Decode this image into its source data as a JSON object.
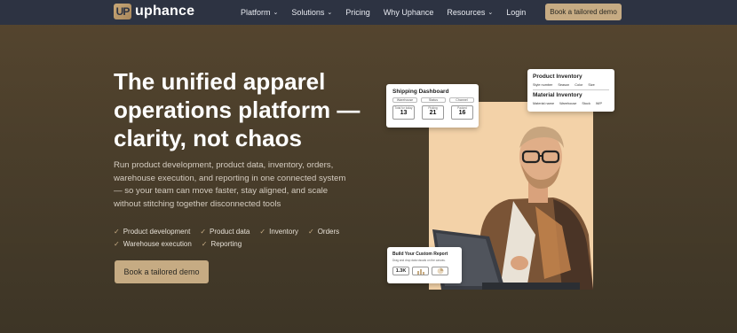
{
  "nav": {
    "brand": "uphance",
    "logo_text": "UP",
    "links": [
      {
        "label": "Platform",
        "has_dropdown": true
      },
      {
        "label": "Solutions",
        "has_dropdown": true
      },
      {
        "label": "Pricing",
        "has_dropdown": false
      },
      {
        "label": "Why Uphance",
        "has_dropdown": false
      },
      {
        "label": "Resources",
        "has_dropdown": true
      },
      {
        "label": "Login",
        "has_dropdown": false
      }
    ],
    "cta_label": "Book a tailored demo"
  },
  "hero": {
    "title": "The unified apparel operations platform — clarity, not chaos",
    "description": "Run product development, product data, inventory, orders, warehouse execution, and reporting in one connected system — so your team can move faster, stay aligned, and scale without stitching together disconnected tools",
    "features": [
      "Product development",
      "Product data",
      "Inventory",
      "Orders",
      "Warehouse execution",
      "Reporting"
    ],
    "cta_label": "Book a tailored demo"
  },
  "shipping_card": {
    "title": "Shipping  Dashboard",
    "filters": [
      "Warehouse",
      "Status",
      "Channel"
    ],
    "stats": [
      {
        "label": "Total for today",
        "value": "13"
      },
      {
        "label": "Picking",
        "value": "21"
      },
      {
        "label": "Packed",
        "value": "16"
      }
    ]
  },
  "inventory_card": {
    "title1": "Product Inventory",
    "cols1": [
      "Style number",
      "Season",
      "Color",
      "Size"
    ],
    "title2": "Material Inventory",
    "cols2": [
      "Material name",
      "Warehouse",
      "Stock",
      "WIP"
    ]
  },
  "report_card": {
    "title": "Build Your Custom Report",
    "subtitle": "Drag and drop data visuals on the canvas.",
    "value": "1.3K"
  },
  "colors": {
    "nav_bg": "#2d3342",
    "accent": "#c6ab83",
    "hero_bg": "#4a3e2b",
    "photo_bg": "#f3d2a8"
  }
}
